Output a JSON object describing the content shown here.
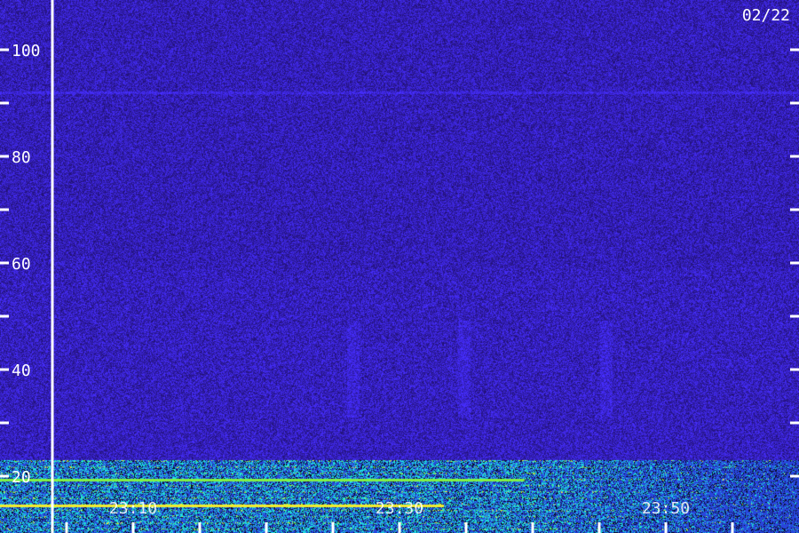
{
  "chart_data": {
    "type": "heatmap",
    "title": "",
    "date_label": "02/22",
    "xlabel": "",
    "ylabel": "",
    "ylim": [
      12,
      110
    ],
    "y_ticks_major": [
      20,
      40,
      60,
      80,
      100
    ],
    "y_ticks_minor": [
      30,
      50,
      70,
      90
    ],
    "x_ticks": [
      "23:10",
      "23:30",
      "23:50"
    ],
    "x_range_minutes": [
      23.0,
      24.0
    ],
    "grid": false,
    "colors": {
      "background": "#2a1a8a",
      "noise_low": "#0a0630",
      "noise_high": "#4b3cff",
      "band_cyan": "#27c9d6",
      "band_yellow": "#f5f23a",
      "axis": "#ffffff"
    },
    "features": {
      "low_freq_band": [
        12,
        23
      ],
      "horizontal_line": 92
    }
  }
}
